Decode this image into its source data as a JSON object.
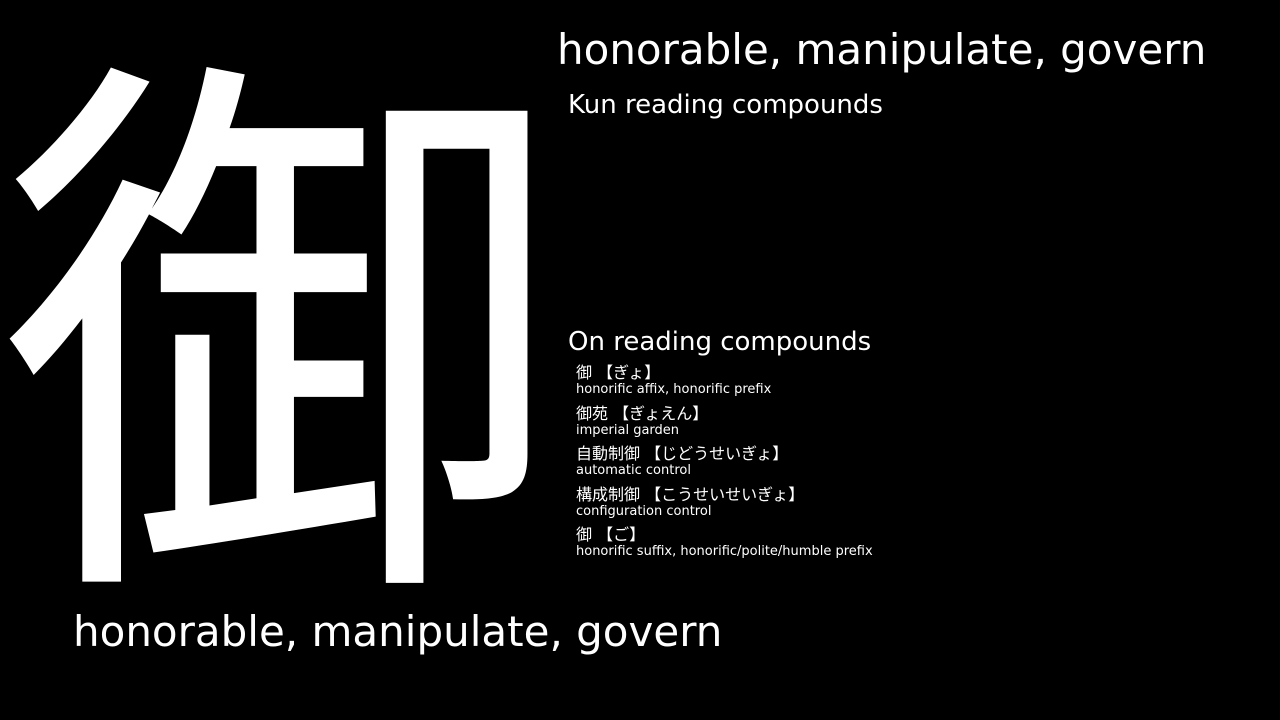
{
  "kanji": "御",
  "meaning_top": "honorable, manipulate, govern",
  "meaning_bottom": "honorable, manipulate, govern",
  "kun_heading": "Kun reading compounds",
  "kun_compounds": [],
  "on_heading": "On reading compounds",
  "on_compounds": [
    {
      "word": "御 【ぎょ】",
      "gloss": "honorific affix, honorific prefix"
    },
    {
      "word": "御苑 【ぎょえん】",
      "gloss": "imperial garden"
    },
    {
      "word": "自動制御 【じどうせいぎょ】",
      "gloss": "automatic control"
    },
    {
      "word": "構成制御 【こうせいせいぎょ】",
      "gloss": "configuration control"
    },
    {
      "word": "御 【ご】",
      "gloss": "honorific suffix, honorific/polite/humble prefix"
    }
  ],
  "colors": {
    "background": "#000000",
    "text": "#ffffff"
  }
}
